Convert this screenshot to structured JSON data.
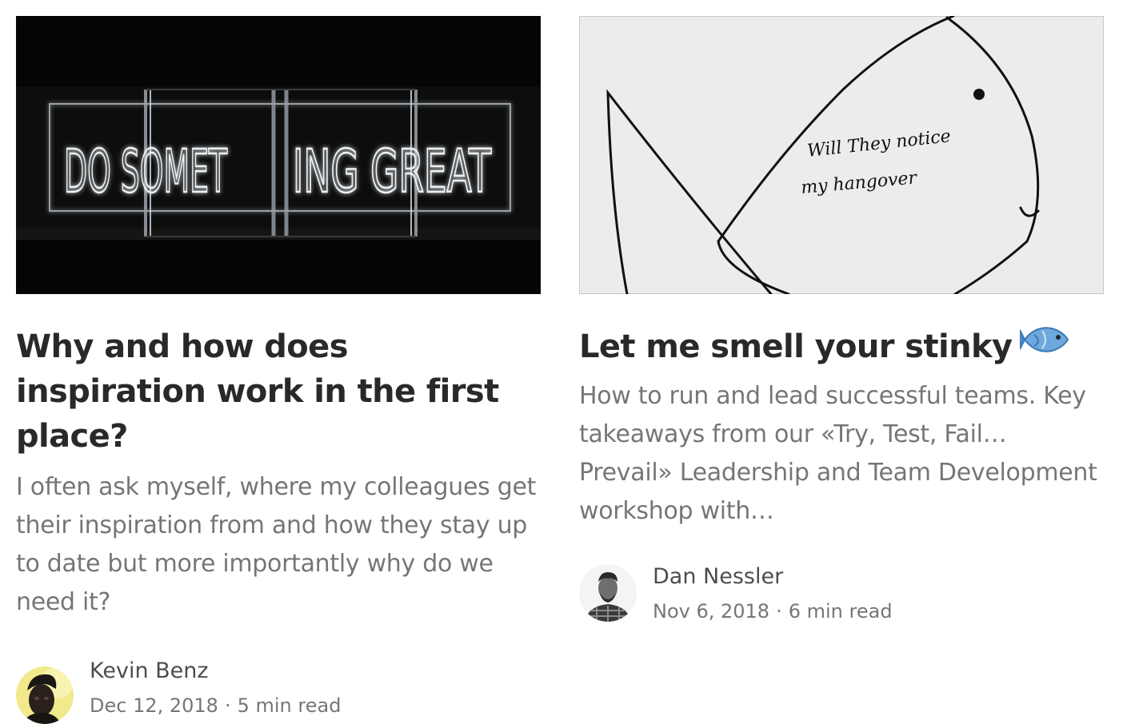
{
  "articles": [
    {
      "title": "Why and how does inspiration work in the first place?",
      "subtitle": "I often ask myself, where my colleagues get their inspiration from and how they stay up to date but more importantly why do we need it?",
      "image": {
        "neon_text": "DO SOMETHING GREAT",
        "neon_left": "DO SOMET",
        "neon_right": "ING GREAT"
      },
      "author": "Kevin Benz",
      "date": "Dec 12, 2018",
      "read_time": "5 min read",
      "separator": "·"
    },
    {
      "title": "Let me smell your stinky",
      "title_emoji": "fish-emoji",
      "subtitle": "How to run and lead successful teams. Key takeaways from our «Try, Test, Fail… Prevail» Leadership and Team Development workshop with…",
      "image": {
        "handwriting_line1": "Will They notice",
        "handwriting_line2": "my hangover"
      },
      "author": "Dan Nessler",
      "date": "Nov 6, 2018",
      "read_time": "6 min read",
      "separator": "·"
    }
  ],
  "colors": {
    "title": "#222222",
    "subtitle": "#757575",
    "member_ring": "#2e9c6e"
  }
}
